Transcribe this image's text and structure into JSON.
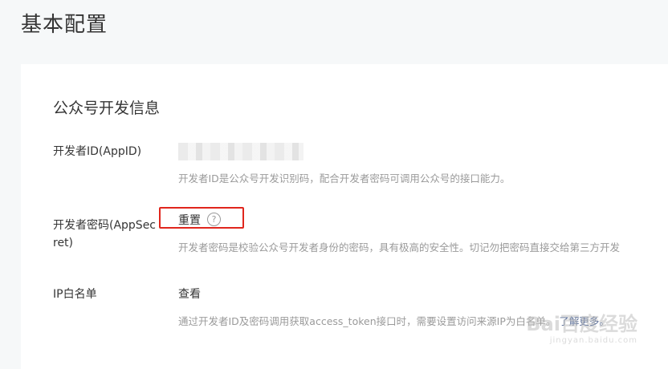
{
  "page": {
    "title": "基本配置"
  },
  "section": {
    "title": "公众号开发信息"
  },
  "rows": {
    "appid": {
      "label": "开发者ID(AppID)",
      "description": "开发者ID是公众号开发识别码，配合开发者密码可调用公众号的接口能力。"
    },
    "appsecret": {
      "label_line1": "开发者密码(AppSec",
      "label_line2": "ret)",
      "action": "重置",
      "description": "开发者密码是校验公众号开发者身份的密码，具有极高的安全性。切记勿把密码直接交给第三方开发"
    },
    "ip_whitelist": {
      "label": "IP白名单",
      "action": "查看",
      "description_prefix": "通过开发者ID及密码调用获取access_token接口时，需要设置访问来源IP为白名单。",
      "learn_more": "了解更多。"
    }
  },
  "icons": {
    "help": "question-circle-icon"
  },
  "watermark": {
    "text": "Bai百度经验",
    "sub": "jingyan.baidu.com"
  }
}
